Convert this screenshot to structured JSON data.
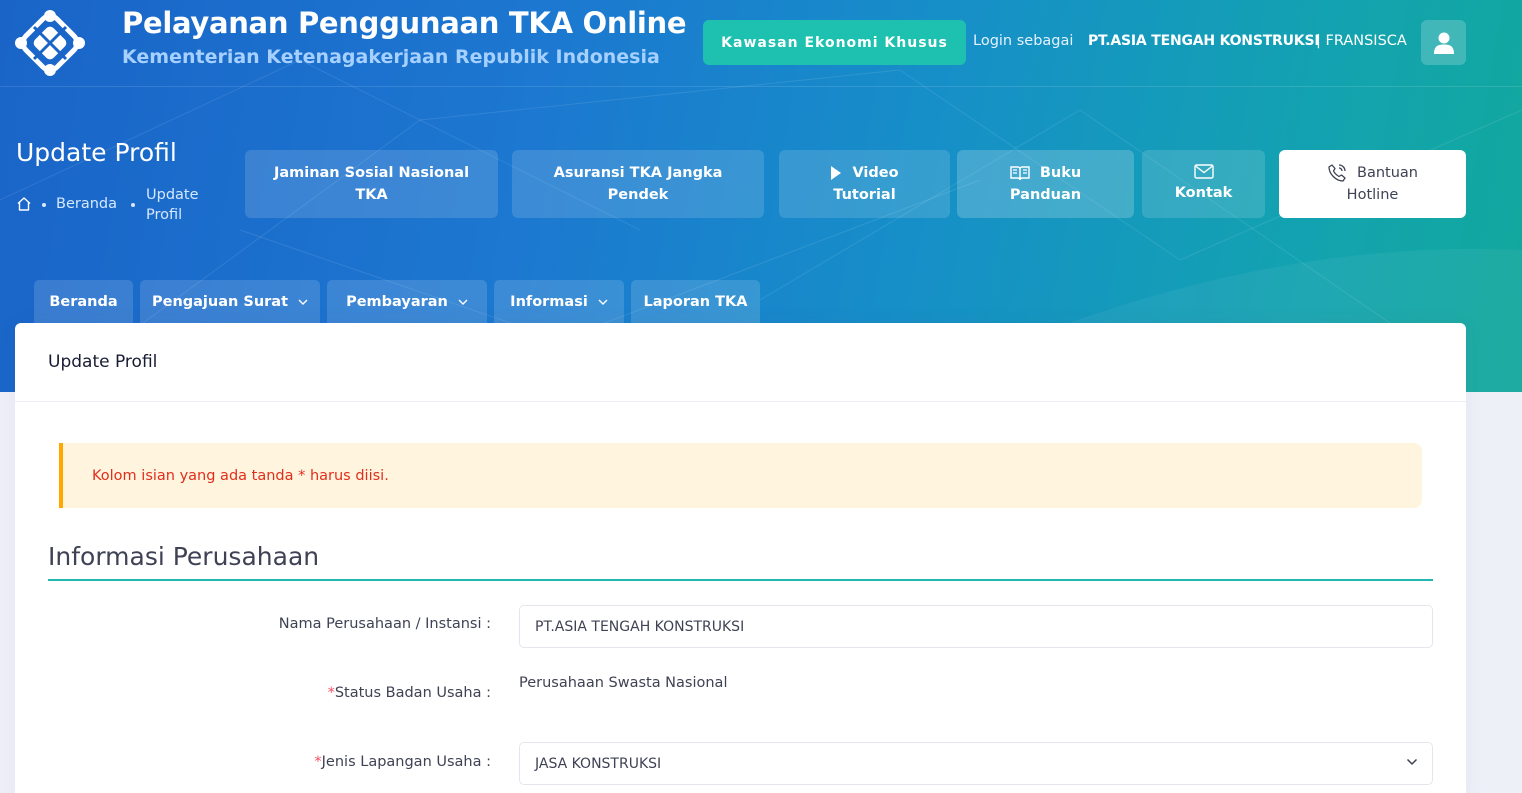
{
  "header": {
    "app_title": "Pelayanan Penggunaan TKA Online",
    "app_subtitle": "Kementerian Ketenagakerjaan Republik Indonesia",
    "kek_button": "Kawasan Ekonomi Khusus",
    "login_label": "Login sebagai",
    "login_company": "PT.ASIA TENGAH KONSTRUKSI",
    "login_user": "| FRANSISCA",
    "avatar_icon": "user-icon"
  },
  "page": {
    "title": "Update Profil",
    "breadcrumb": [
      "Beranda",
      "Update Profil"
    ]
  },
  "quick_links": [
    {
      "label": "Jaminan Sosial Nasional TKA",
      "icon": ""
    },
    {
      "label": "Asuransi TKA Jangka Pendek",
      "icon": ""
    },
    {
      "label_top": "Video",
      "label_bottom": "Tutorial",
      "icon": "play-icon"
    },
    {
      "label_top": "Buku",
      "label_bottom": "Panduan",
      "icon": "book-icon"
    },
    {
      "label_top": "",
      "label_bottom": "Kontak",
      "icon": "mail-icon"
    },
    {
      "label_top": "Bantuan",
      "label_bottom": "Hotline",
      "icon": "phone-icon"
    }
  ],
  "nav_tabs": [
    {
      "label": "Beranda",
      "dropdown": false
    },
    {
      "label": "Pengajuan Surat",
      "dropdown": true
    },
    {
      "label": "Pembayaran",
      "dropdown": true
    },
    {
      "label": "Informasi",
      "dropdown": true
    },
    {
      "label": "Laporan TKA",
      "dropdown": false
    }
  ],
  "card": {
    "title": "Update Profil",
    "alert": "Kolom isian yang ada tanda * harus diisi.",
    "section_title": "Informasi Perusahaan",
    "fields": [
      {
        "label": "Nama Perusahaan / Instansi :",
        "required": false,
        "value": "PT.ASIA TENGAH KONSTRUKSI",
        "type": "text"
      },
      {
        "label": "Status Badan Usaha :",
        "required": true,
        "value": "Perusahaan Swasta Nasional",
        "type": "static"
      },
      {
        "label": "Jenis Lapangan Usaha :",
        "required": true,
        "value": "JASA KONSTRUKSI",
        "type": "select"
      }
    ]
  },
  "colors": {
    "hero_start": "#1a64c8",
    "hero_end": "#12a89c",
    "accent_teal": "#1ec0b0",
    "alert_bg": "#fff4de",
    "alert_border": "#ffa800",
    "alert_text": "#e12e1c",
    "required_star": "#f64e60"
  }
}
